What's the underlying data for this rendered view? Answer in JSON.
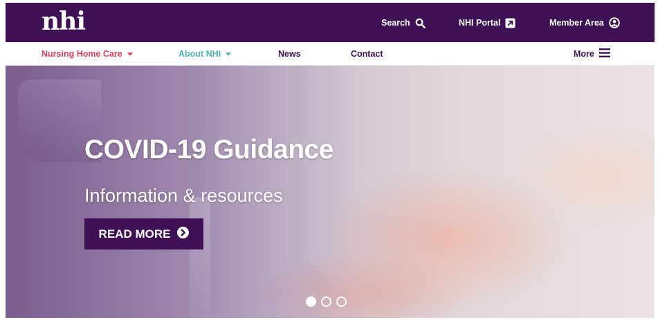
{
  "header": {
    "logo": "nhi",
    "search_label": "Search",
    "portal_label": "NHI Portal",
    "member_label": "Member Area"
  },
  "nav": {
    "items": [
      {
        "label": "Nursing Home Care",
        "color": "#e2425f",
        "dropdown": true
      },
      {
        "label": "About NHI",
        "color": "#4db6ac",
        "dropdown": true
      },
      {
        "label": "News",
        "color": "#3e1156",
        "dropdown": false
      },
      {
        "label": "Contact",
        "color": "#3e1156",
        "dropdown": false
      }
    ],
    "more_label": "More"
  },
  "hero": {
    "title": "COVID-19 Guidance",
    "subtitle": "Information & resources",
    "button_label": "READ MORE",
    "slides": 3,
    "active_slide": 1
  },
  "colors": {
    "brand_purple": "#3e1156",
    "nav_red": "#e2425f",
    "nav_teal": "#4db6ac"
  }
}
